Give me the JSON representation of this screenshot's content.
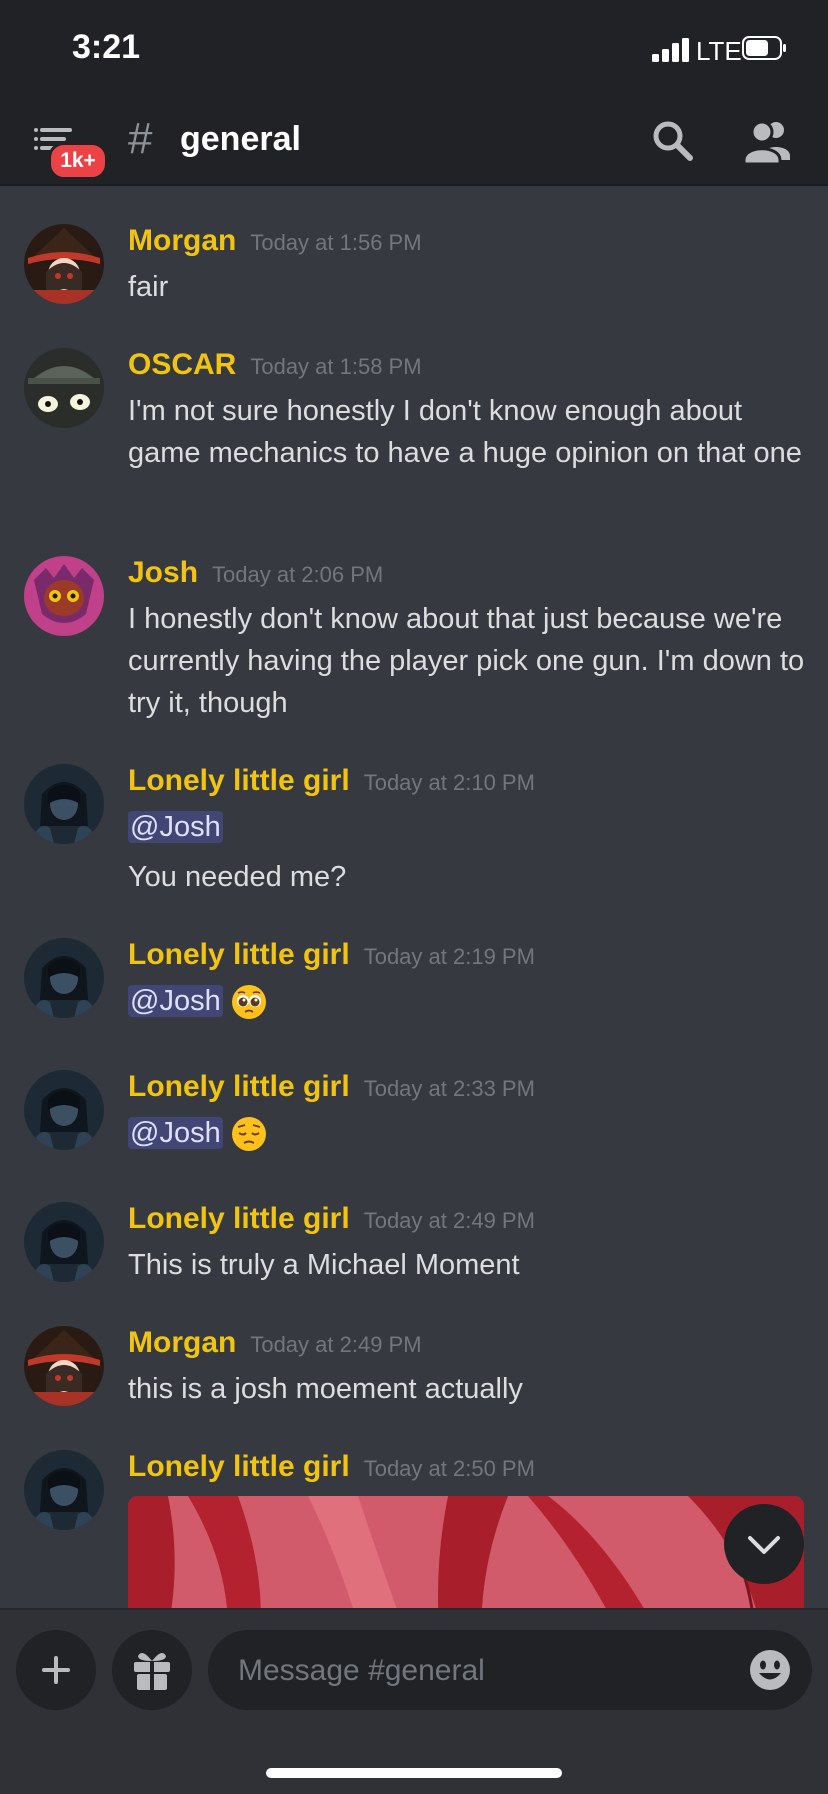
{
  "status_bar": {
    "time": "3:21",
    "network": "LTE"
  },
  "header": {
    "badge": "1k+",
    "hash": "#",
    "channel_name": "general"
  },
  "messages": [
    {
      "author": "Morgan",
      "timestamp": "Today at 1:56 PM",
      "lines": [
        "fair"
      ]
    },
    {
      "author": "OSCAR",
      "timestamp": "Today at 1:58 PM",
      "lines": [
        "I'm not sure honestly I don't know enough about game mechanics to have a huge opinion on that one"
      ]
    },
    {
      "author": "Josh",
      "timestamp": "Today at 2:06 PM",
      "lines": [
        "I honestly don't know about that just because we're currently having the player pick one gun. I'm down to try it, though"
      ]
    },
    {
      "author": "Lonely little girl",
      "timestamp": "Today at 2:10 PM",
      "mention": "@Josh",
      "lines": [
        "You needed me?"
      ]
    },
    {
      "author": "Lonely little girl",
      "timestamp": "Today at 2:19 PM",
      "mention": "@Josh",
      "emoji": "pleading-face"
    },
    {
      "author": "Lonely little girl",
      "timestamp": "Today at 2:33 PM",
      "mention": "@Josh",
      "emoji": "pensive-face"
    },
    {
      "author": "Lonely little girl",
      "timestamp": "Today at 2:49 PM",
      "lines": [
        "This is truly a Michael Moment"
      ]
    },
    {
      "author": "Morgan",
      "timestamp": "Today at 2:49 PM",
      "lines": [
        "this is a josh moement actually"
      ]
    },
    {
      "author": "Lonely little girl",
      "timestamp": "Today at 2:50 PM",
      "attachment": "image"
    }
  ],
  "composer": {
    "placeholder": "Message #general"
  },
  "colors": {
    "background": "#36393f",
    "header": "#202225",
    "username": "#f1c40f",
    "badge": "#ed4245",
    "mention_bg": "#414675"
  },
  "icons": [
    "menu-icon",
    "search-icon",
    "members-icon",
    "plus-icon",
    "gift-icon",
    "emoji-icon",
    "chevron-down-icon"
  ]
}
